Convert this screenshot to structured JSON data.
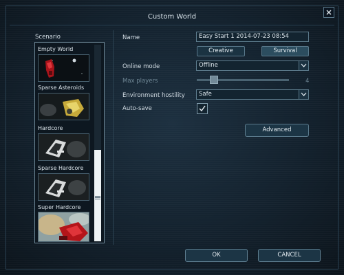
{
  "window": {
    "title": "Custom World"
  },
  "close_icon": "close-icon",
  "scenario": {
    "heading": "Scenario",
    "items": [
      {
        "label": "Empty World"
      },
      {
        "label": "Sparse Asteroids"
      },
      {
        "label": "Hardcore"
      },
      {
        "label": "Sparse Hardcore"
      },
      {
        "label": "Super Hardcore"
      }
    ],
    "scroll_position": 0.55
  },
  "settings": {
    "name_label": "Name",
    "name_value": "Easy Start 1 2014-07-23 08:54",
    "mode_buttons": [
      {
        "label": "Creative",
        "selected": false
      },
      {
        "label": "Survival",
        "selected": true
      }
    ],
    "online_mode_label": "Online mode",
    "online_mode_value": "Offline",
    "max_players_label": "Max players",
    "max_players_value": "4",
    "environment_hostility_label": "Environment hostility",
    "environment_hostility_value": "Safe",
    "autosave_label": "Auto-save",
    "autosave_checked": true,
    "advanced_label": "Advanced"
  },
  "footer": {
    "ok_label": "OK",
    "cancel_label": "CANCEL"
  },
  "colors": {
    "background": "#0e1822",
    "border": "#5d7c8d",
    "text": "#d5dfe6"
  }
}
